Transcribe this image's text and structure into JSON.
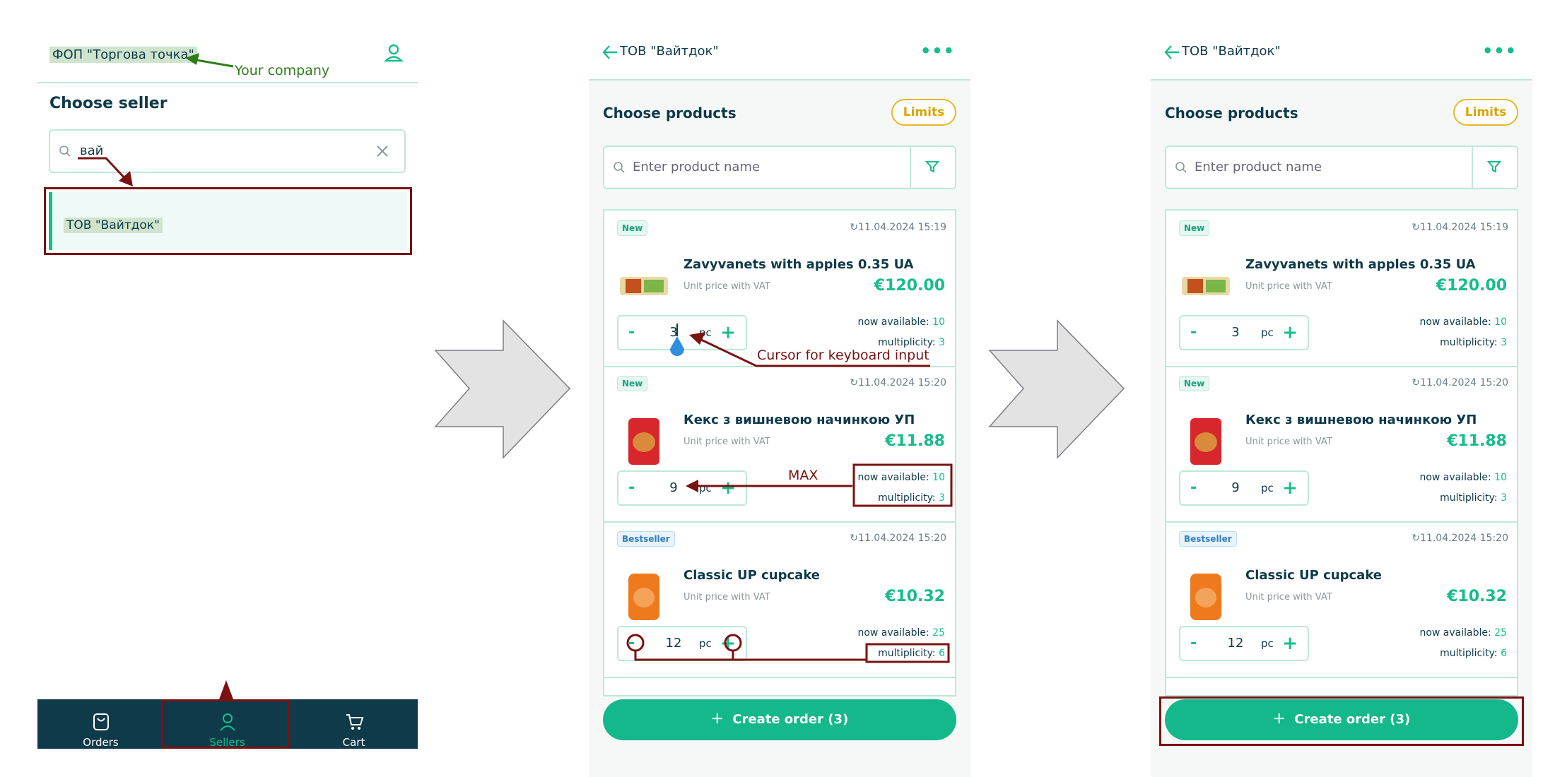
{
  "panel1": {
    "company": "ФОП \"Торгова точка\"",
    "company_note": "Your company",
    "choose_seller": "Choose seller",
    "search_value": "вай",
    "result": "ТОВ \"Вайтдок\"",
    "nav": [
      {
        "label": "Orders",
        "icon": "shopping-bag-icon"
      },
      {
        "label": "Sellers",
        "icon": "user-icon"
      },
      {
        "label": "Cart",
        "icon": "cart-icon"
      }
    ]
  },
  "panel2": {
    "title": "ТОВ \"Вайтдок\"",
    "choose_products": "Choose products",
    "limits": "Limits",
    "search_placeholder": "Enter product name",
    "products": [
      {
        "badge": "New",
        "date": "11.04.2024 15:19",
        "name": "Zavyvanets with apples 0.35 UA",
        "unit_price_label": "Unit price with VAT",
        "price": "€120.00",
        "qty": "3",
        "unit": "pc",
        "avail_label": "now available:",
        "avail": "10",
        "mult_label": "multiplicity:",
        "mult": "3"
      },
      {
        "badge": "New",
        "date": "11.04.2024 15:20",
        "name": "Кекс з вишневою начинкою УП",
        "unit_price_label": "Unit price with VAT",
        "price": "€11.88",
        "qty": "9",
        "unit": "pc",
        "avail_label": "now available:",
        "avail": "10",
        "mult_label": "multiplicity:",
        "mult": "3"
      },
      {
        "badge": "Bestseller",
        "date": "11.04.2024 15:20",
        "name": "Classic UP cupcake",
        "unit_price_label": "Unit price with VAT",
        "price": "€10.32",
        "qty": "12",
        "unit": "pc",
        "avail_label": "now available:",
        "avail": "25",
        "mult_label": "multiplicity:",
        "mult": "6"
      }
    ],
    "create_order": "Create order  (3)",
    "annotations": {
      "cursor": "Cursor for keyboard input",
      "max": "MAX"
    }
  },
  "panel3": {
    "title": "ТОВ \"Вайтдок\"",
    "choose_products": "Choose products",
    "limits": "Limits",
    "search_placeholder": "Enter product name",
    "products": [
      {
        "badge": "New",
        "date": "11.04.2024 15:19",
        "name": "Zavyvanets with apples 0.35 UA",
        "unit_price_label": "Unit price with VAT",
        "price": "€120.00",
        "qty": "3",
        "unit": "pc",
        "avail_label": "now available:",
        "avail": "10",
        "mult_label": "multiplicity:",
        "mult": "3"
      },
      {
        "badge": "New",
        "date": "11.04.2024 15:20",
        "name": "Кекс з вишневою начинкою УП",
        "unit_price_label": "Unit price with VAT",
        "price": "€11.88",
        "qty": "9",
        "unit": "pc",
        "avail_label": "now available:",
        "avail": "10",
        "mult_label": "multiplicity:",
        "mult": "3"
      },
      {
        "badge": "Bestseller",
        "date": "11.04.2024 15:20",
        "name": "Classic UP cupcake",
        "unit_price_label": "Unit price with VAT",
        "price": "€10.32",
        "qty": "12",
        "unit": "pc",
        "avail_label": "now available:",
        "avail": "25",
        "mult_label": "multiplicity:",
        "mult": "6"
      }
    ],
    "create_order": "Create order  (3)"
  },
  "colors": {
    "brand": "#16bd8c",
    "dark": "#0e3a4a",
    "annotation": "#7a1212",
    "limits": "#e5b928"
  }
}
